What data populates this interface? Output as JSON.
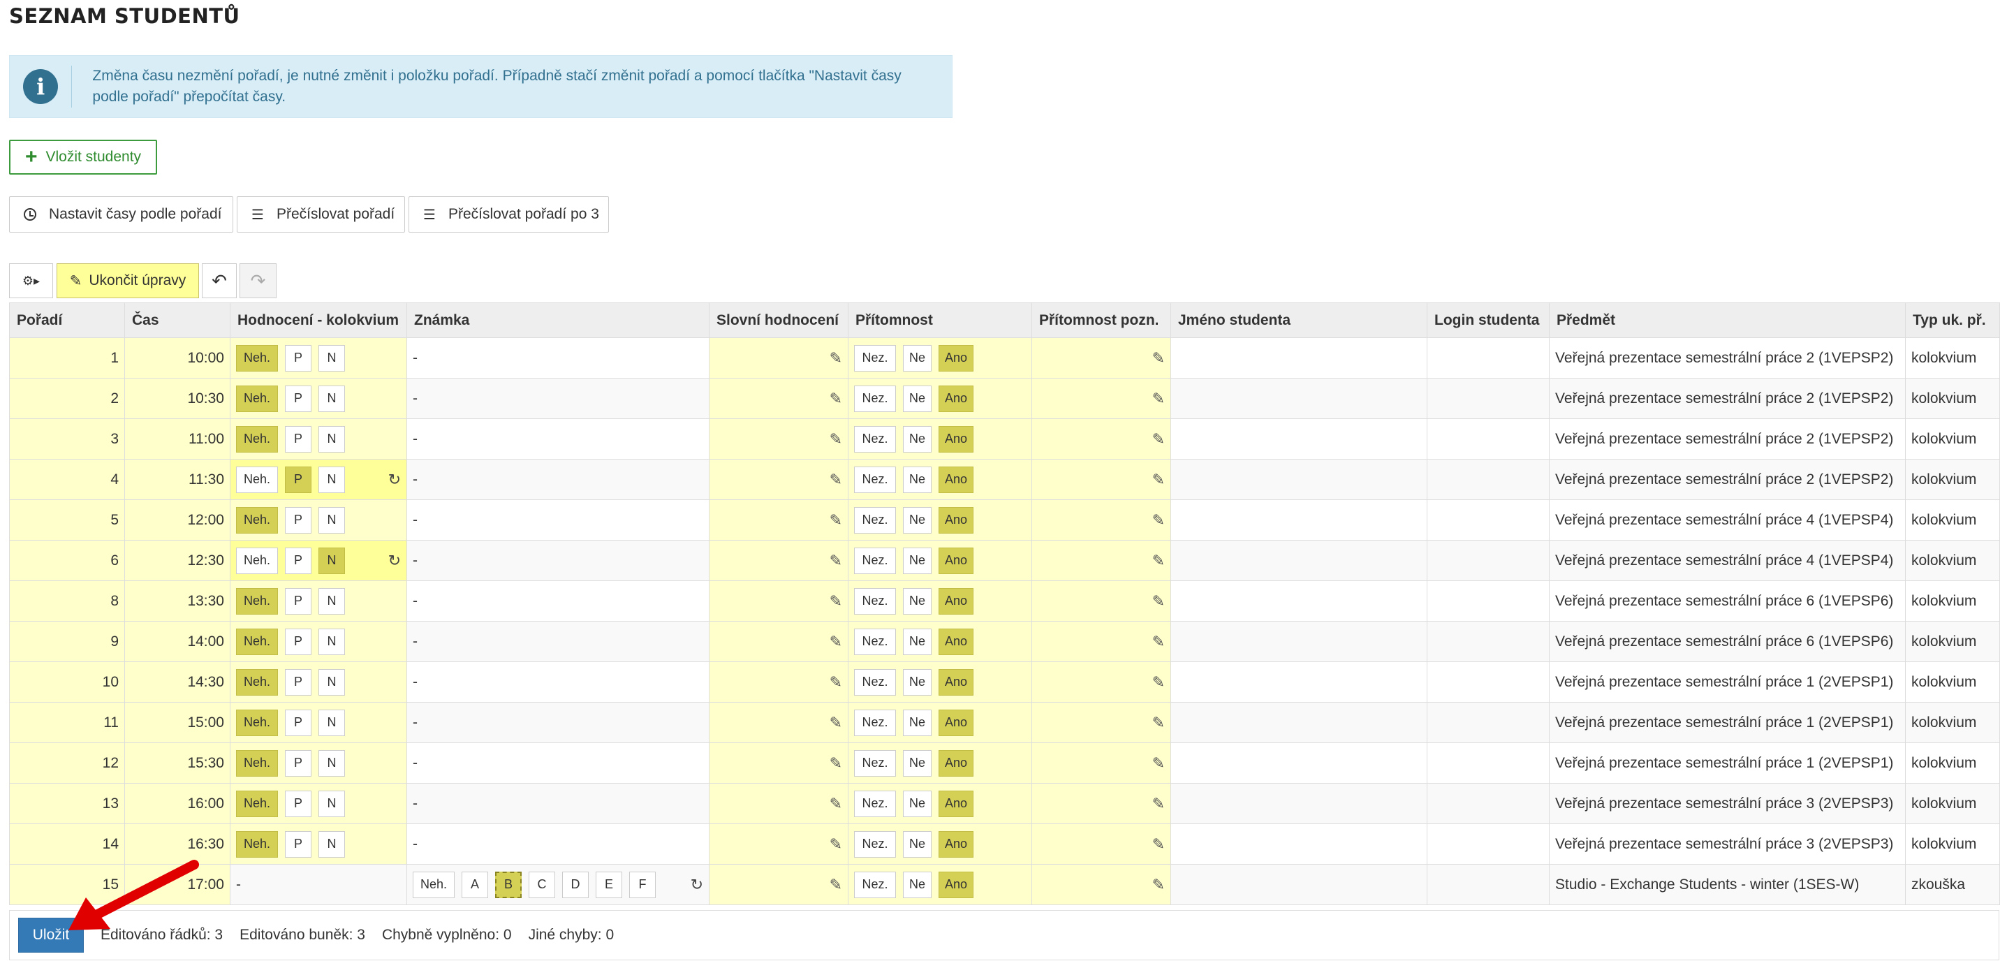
{
  "page": {
    "title": "SEZNAM STUDENTŮ",
    "alert": "Změna času nezmění pořadí, je nutné změnit i položku pořadí. Případně stačí změnit pořadí a pomocí tlačítka \"Nastavit časy podle pořadí\" přepočítat časy."
  },
  "actions": {
    "add_students": "Vložit studenty",
    "set_times": "Nastavit časy podle pořadí",
    "renumber": "Přečíslovat pořadí",
    "renumber_by3": "Přečíslovat pořadí po 3"
  },
  "toolbar": {
    "end_edit": "Ukončit úpravy"
  },
  "table": {
    "columns": [
      "Pořadí",
      "Čas",
      "Hodnocení - kolokvium",
      "Známka",
      "Slovní hodnocení",
      "Přítomnost",
      "Přítomnost pozn.",
      "Jméno studenta",
      "Login studenta",
      "Předmět",
      "Typ uk. př."
    ],
    "rows": [
      {
        "order": "1",
        "time": "10:00",
        "eval": "Neh.",
        "grade": "-",
        "present": "Ano",
        "subject": "Veřejná prezentace semestrální práce 2 (1VEPSP2)",
        "type": "kolokvium"
      },
      {
        "order": "2",
        "time": "10:30",
        "eval": "Neh.",
        "grade": "-",
        "present": "Ano",
        "subject": "Veřejná prezentace semestrální práce 2 (1VEPSP2)",
        "type": "kolokvium"
      },
      {
        "order": "3",
        "time": "11:00",
        "eval": "Neh.",
        "grade": "-",
        "present": "Ano",
        "subject": "Veřejná prezentace semestrální práce 2 (1VEPSP2)",
        "type": "kolokvium"
      },
      {
        "order": "4",
        "time": "11:30",
        "eval": "P",
        "edited": true,
        "grade": "-",
        "present": "Ano",
        "subject": "Veřejná prezentace semestrální práce 2 (1VEPSP2)",
        "type": "kolokvium"
      },
      {
        "order": "5",
        "time": "12:00",
        "eval": "Neh.",
        "grade": "-",
        "present": "Ano",
        "subject": "Veřejná prezentace semestrální práce 4 (1VEPSP4)",
        "type": "kolokvium"
      },
      {
        "order": "6",
        "time": "12:30",
        "eval": "N",
        "edited": true,
        "grade": "-",
        "present": "Ano",
        "subject": "Veřejná prezentace semestrální práce 4 (1VEPSP4)",
        "type": "kolokvium"
      },
      {
        "order": "8",
        "time": "13:30",
        "eval": "Neh.",
        "grade": "-",
        "present": "Ano",
        "subject": "Veřejná prezentace semestrální práce 6 (1VEPSP6)",
        "type": "kolokvium"
      },
      {
        "order": "9",
        "time": "14:00",
        "eval": "Neh.",
        "grade": "-",
        "present": "Ano",
        "subject": "Veřejná prezentace semestrální práce 6 (1VEPSP6)",
        "type": "kolokvium"
      },
      {
        "order": "10",
        "time": "14:30",
        "eval": "Neh.",
        "grade": "-",
        "present": "Ano",
        "subject": "Veřejná prezentace semestrální práce 1 (2VEPSP1)",
        "type": "kolokvium"
      },
      {
        "order": "11",
        "time": "15:00",
        "eval": "Neh.",
        "grade": "-",
        "present": "Ano",
        "subject": "Veřejná prezentace semestrální práce 1 (2VEPSP1)",
        "type": "kolokvium"
      },
      {
        "order": "12",
        "time": "15:30",
        "eval": "Neh.",
        "grade": "-",
        "present": "Ano",
        "subject": "Veřejná prezentace semestrální práce 1 (2VEPSP1)",
        "type": "kolokvium"
      },
      {
        "order": "13",
        "time": "16:00",
        "eval": "Neh.",
        "grade": "-",
        "present": "Ano",
        "subject": "Veřejná prezentace semestrální práce 3 (2VEPSP3)",
        "type": "kolokvium"
      },
      {
        "order": "14",
        "time": "16:30",
        "eval": "Neh.",
        "grade": "-",
        "present": "Ano",
        "subject": "Veřejná prezentace semestrální práce 3 (2VEPSP3)",
        "type": "kolokvium"
      },
      {
        "order": "15",
        "time": "17:00",
        "eval_text": "-",
        "grade_options": [
          "Neh.",
          "A",
          "B",
          "C",
          "D",
          "E",
          "F"
        ],
        "grade_selected": "B",
        "present": "Ano",
        "subject": "Studio - Exchange Students - winter (1SES-W)",
        "type": "zkouška"
      }
    ],
    "eval_options": [
      "Neh.",
      "P",
      "N"
    ],
    "presence_options": [
      "Nez.",
      "Ne",
      "Ano"
    ]
  },
  "footer": {
    "save": "Uložit",
    "edited_rows": "Editováno řádků: 3",
    "edited_cells": "Editováno buněk: 3",
    "errors": "Chybně vyplněno: 0",
    "other_errors": "Jiné chyby: 0"
  },
  "colors": {
    "accent": "#337ab7",
    "selected_chip": "#d4cf55",
    "edit_cell": "#ffffcc",
    "arrow": "#e00000"
  }
}
